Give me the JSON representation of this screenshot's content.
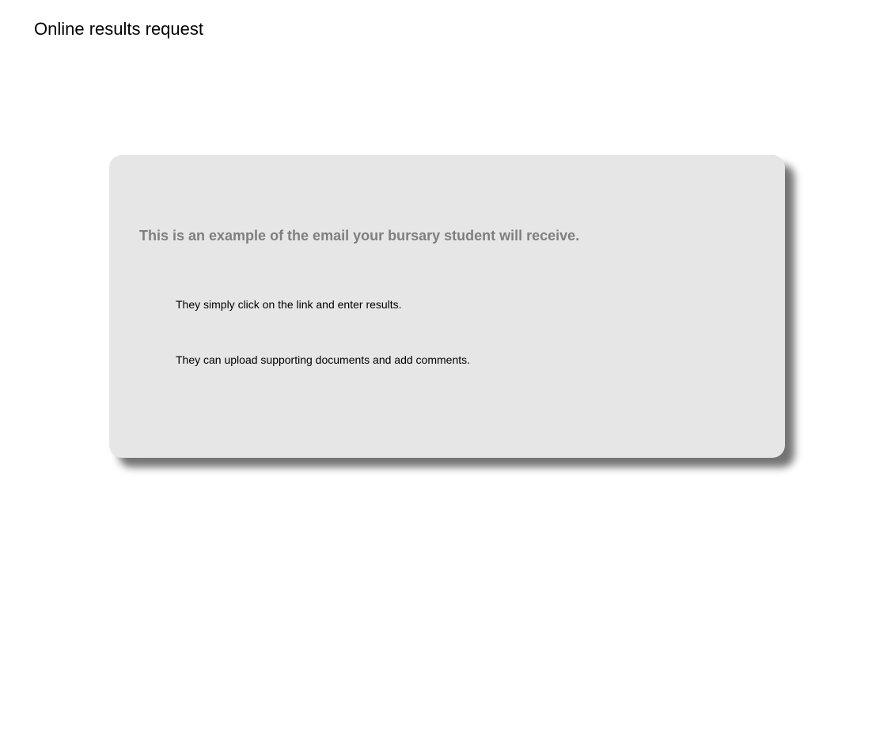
{
  "page": {
    "title": "Online results request"
  },
  "card": {
    "heading": "This is an example of the email your bursary student will receive.",
    "lines": [
      "They simply click on the link and enter results.",
      "They can upload supporting documents and add comments."
    ],
    "colors": {
      "background": "#e6e6e6",
      "heading": "#7f7f7f"
    }
  }
}
